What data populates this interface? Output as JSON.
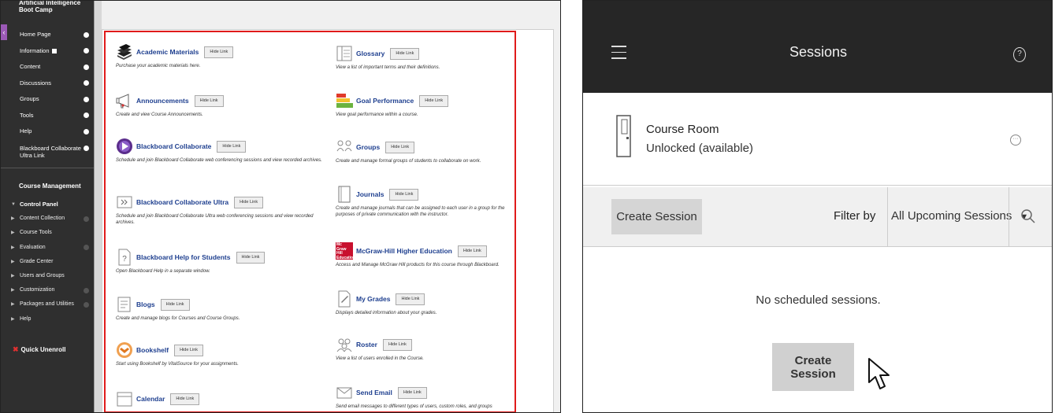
{
  "sidebar": {
    "course_title": "Artificial Intelligence Boot Camp",
    "collapse_glyph": "‹",
    "items": [
      {
        "label": "Home Page"
      },
      {
        "label": "Information"
      },
      {
        "label": "Content"
      },
      {
        "label": "Discussions"
      },
      {
        "label": "Groups"
      },
      {
        "label": "Tools"
      },
      {
        "label": "Help"
      },
      {
        "label": "Blackboard Collaborate Ultra Link"
      }
    ],
    "course_management": "Course Management",
    "control_panel": "Control Panel",
    "cp_items": [
      {
        "label": "Content Collection"
      },
      {
        "label": "Course Tools"
      },
      {
        "label": "Evaluation"
      },
      {
        "label": "Grade Center"
      },
      {
        "label": "Users and Groups"
      },
      {
        "label": "Customization"
      },
      {
        "label": "Packages and Utilities"
      },
      {
        "label": "Help"
      }
    ],
    "quick_unenroll": "Quick Unenroll"
  },
  "tools": {
    "hide_label": "Hide Link",
    "left": [
      {
        "name": "Academic Materials",
        "desc": "Purchase your academic materials here.",
        "icon": "books-icon"
      },
      {
        "name": "Announcements",
        "desc": "Create and view Course Announcements.",
        "icon": "megaphone-icon"
      },
      {
        "name": "Blackboard Collaborate",
        "desc": "Schedule and join Blackboard Collaborate web conferencing sessions and view recorded archives.",
        "icon": "collaborate-icon"
      },
      {
        "name": "Blackboard Collaborate Ultra",
        "desc": "Schedule and join Blackboard Collaborate Ultra web conferencing sessions and view recorded archives.",
        "icon": "collaborate-ultra-icon"
      },
      {
        "name": "Blackboard Help for Students",
        "desc": "Open Blackboard Help in a separate window.",
        "icon": "help-document-icon"
      },
      {
        "name": "Blogs",
        "desc": "Create and manage blogs for Courses and Course Groups.",
        "icon": "blog-icon"
      },
      {
        "name": "Bookshelf",
        "desc": "Start using Bookshelf by VitalSource for your assignments.",
        "icon": "bookshelf-icon"
      },
      {
        "name": "Calendar",
        "desc": "",
        "icon": "calendar-icon"
      }
    ],
    "right": [
      {
        "name": "Glossary",
        "desc": "View a list of important terms and their definitions.",
        "icon": "glossary-icon"
      },
      {
        "name": "Goal Performance",
        "desc": "View goal performance within a course.",
        "icon": "goal-performance-icon"
      },
      {
        "name": "Groups",
        "desc": "Create and manage formal groups of students to collaborate on work.",
        "icon": "groups-icon"
      },
      {
        "name": "Journals",
        "desc": "Create and manage journals that can be assigned to each user in a group for the purposes of private communication with the instructor.",
        "icon": "journal-icon"
      },
      {
        "name": "McGraw-Hill Higher Education",
        "desc": "Access and Manage McGraw Hill products for this course through Blackboard.",
        "icon": "mcgraw-hill-icon",
        "logo_text": "Mc Graw Hill Education"
      },
      {
        "name": "My Grades",
        "desc": "Displays detailed information about your grades.",
        "icon": "grades-icon"
      },
      {
        "name": "Roster",
        "desc": "View a list of users enrolled in the Course.",
        "icon": "roster-icon"
      },
      {
        "name": "Send Email",
        "desc": "Send email messages to different types of users, custom roles, and groups",
        "icon": "email-icon"
      }
    ]
  },
  "sessions": {
    "title": "Sessions",
    "help_glyph": "?",
    "more_glyph": "···",
    "room_title": "Course Room",
    "room_status": "Unlocked (available)",
    "create_label": "Create Session",
    "filter_label": "Filter by",
    "filter_value": "All Upcoming Sessions",
    "filter_caret": "▼",
    "empty_message": "No scheduled sessions.",
    "main_create_label": "Create Session"
  },
  "colors": {
    "sidebar_bg": "#2f2f2f",
    "highlight_border": "#e01b1b",
    "tool_link": "#1e3f8f",
    "topbar_bg": "#262626",
    "button_bg": "#d5d5d5"
  }
}
